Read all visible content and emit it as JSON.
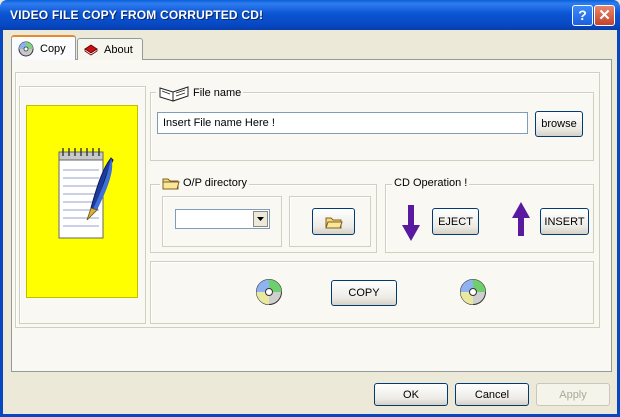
{
  "window": {
    "title": "VIDEO FILE COPY FROM CORRUPTED CD!",
    "help_glyph": "?",
    "close_glyph": "✕"
  },
  "tabs": [
    {
      "label": "Copy",
      "icon": "cd-icon",
      "selected": true
    },
    {
      "label": "About",
      "icon": "red-book-icon",
      "selected": false
    }
  ],
  "file_name": {
    "legend": "File  name",
    "value": "Insert  File name  Here !",
    "browse_label": "browse"
  },
  "op_directory": {
    "legend": "O/P directory",
    "selected": ""
  },
  "cd_operation": {
    "legend": "CD Operation !",
    "eject_label": "EJECT",
    "insert_label": "INSERT"
  },
  "copy_label": "COPY",
  "footer": {
    "ok": "OK",
    "cancel": "Cancel",
    "apply": "Apply"
  },
  "colors": {
    "title_bar": "#0847c2",
    "yellow_panel": "#ffff00",
    "arrow": "#5a1aa0",
    "face": "#ece9d8"
  }
}
